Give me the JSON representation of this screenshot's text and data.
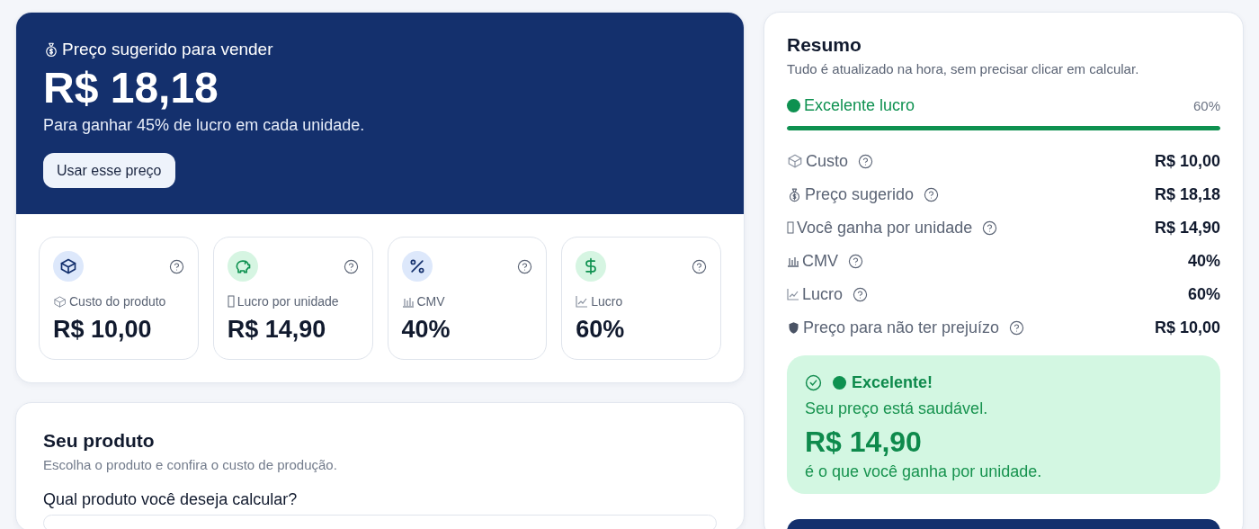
{
  "hero": {
    "label": "Preço sugerido para vender",
    "price": "R$ 18,18",
    "subtitle": "Para ganhar 45% de lucro em cada unidade.",
    "button": "Usar esse preço"
  },
  "stats": [
    {
      "label": "Custo do produto",
      "value": "R$ 10,00",
      "color": "#dde8fb"
    },
    {
      "label": "Lucro por unidade",
      "value": "R$ 14,90",
      "color": "#d6f5e2"
    },
    {
      "label": "CMV",
      "value": "40%",
      "color": "#dde8fb"
    },
    {
      "label": "Lucro",
      "value": "60%",
      "color": "#d6f5e2"
    }
  ],
  "product": {
    "title": "Seu produto",
    "subtitle": "Escolha o produto e confira o custo de produção.",
    "question": "Qual produto você deseja calcular?"
  },
  "summary": {
    "title": "Resumo",
    "subtitle": "Tudo é atualizado na hora, sem precisar clicar em calcular.",
    "status": "Excelente lucro",
    "status_value": "60%",
    "level": 1,
    "rows": [
      {
        "label": "Custo",
        "value": "R$ 10,00"
      },
      {
        "label": "Preço sugerido",
        "value": "R$ 18,18"
      },
      {
        "label": "Você ganha por unidade",
        "value": "R$ 14,90"
      },
      {
        "label": "CMV",
        "value": "40%"
      },
      {
        "label": "Lucro",
        "value": "60%"
      },
      {
        "label": "Preço para não ter prejuízo",
        "value": "R$ 10,00"
      }
    ],
    "alert": {
      "title": "Excelente!",
      "message": "Seu preço está saudável.",
      "value": "R$ 14,90",
      "caption": "é o que você ganha por unidade."
    }
  }
}
